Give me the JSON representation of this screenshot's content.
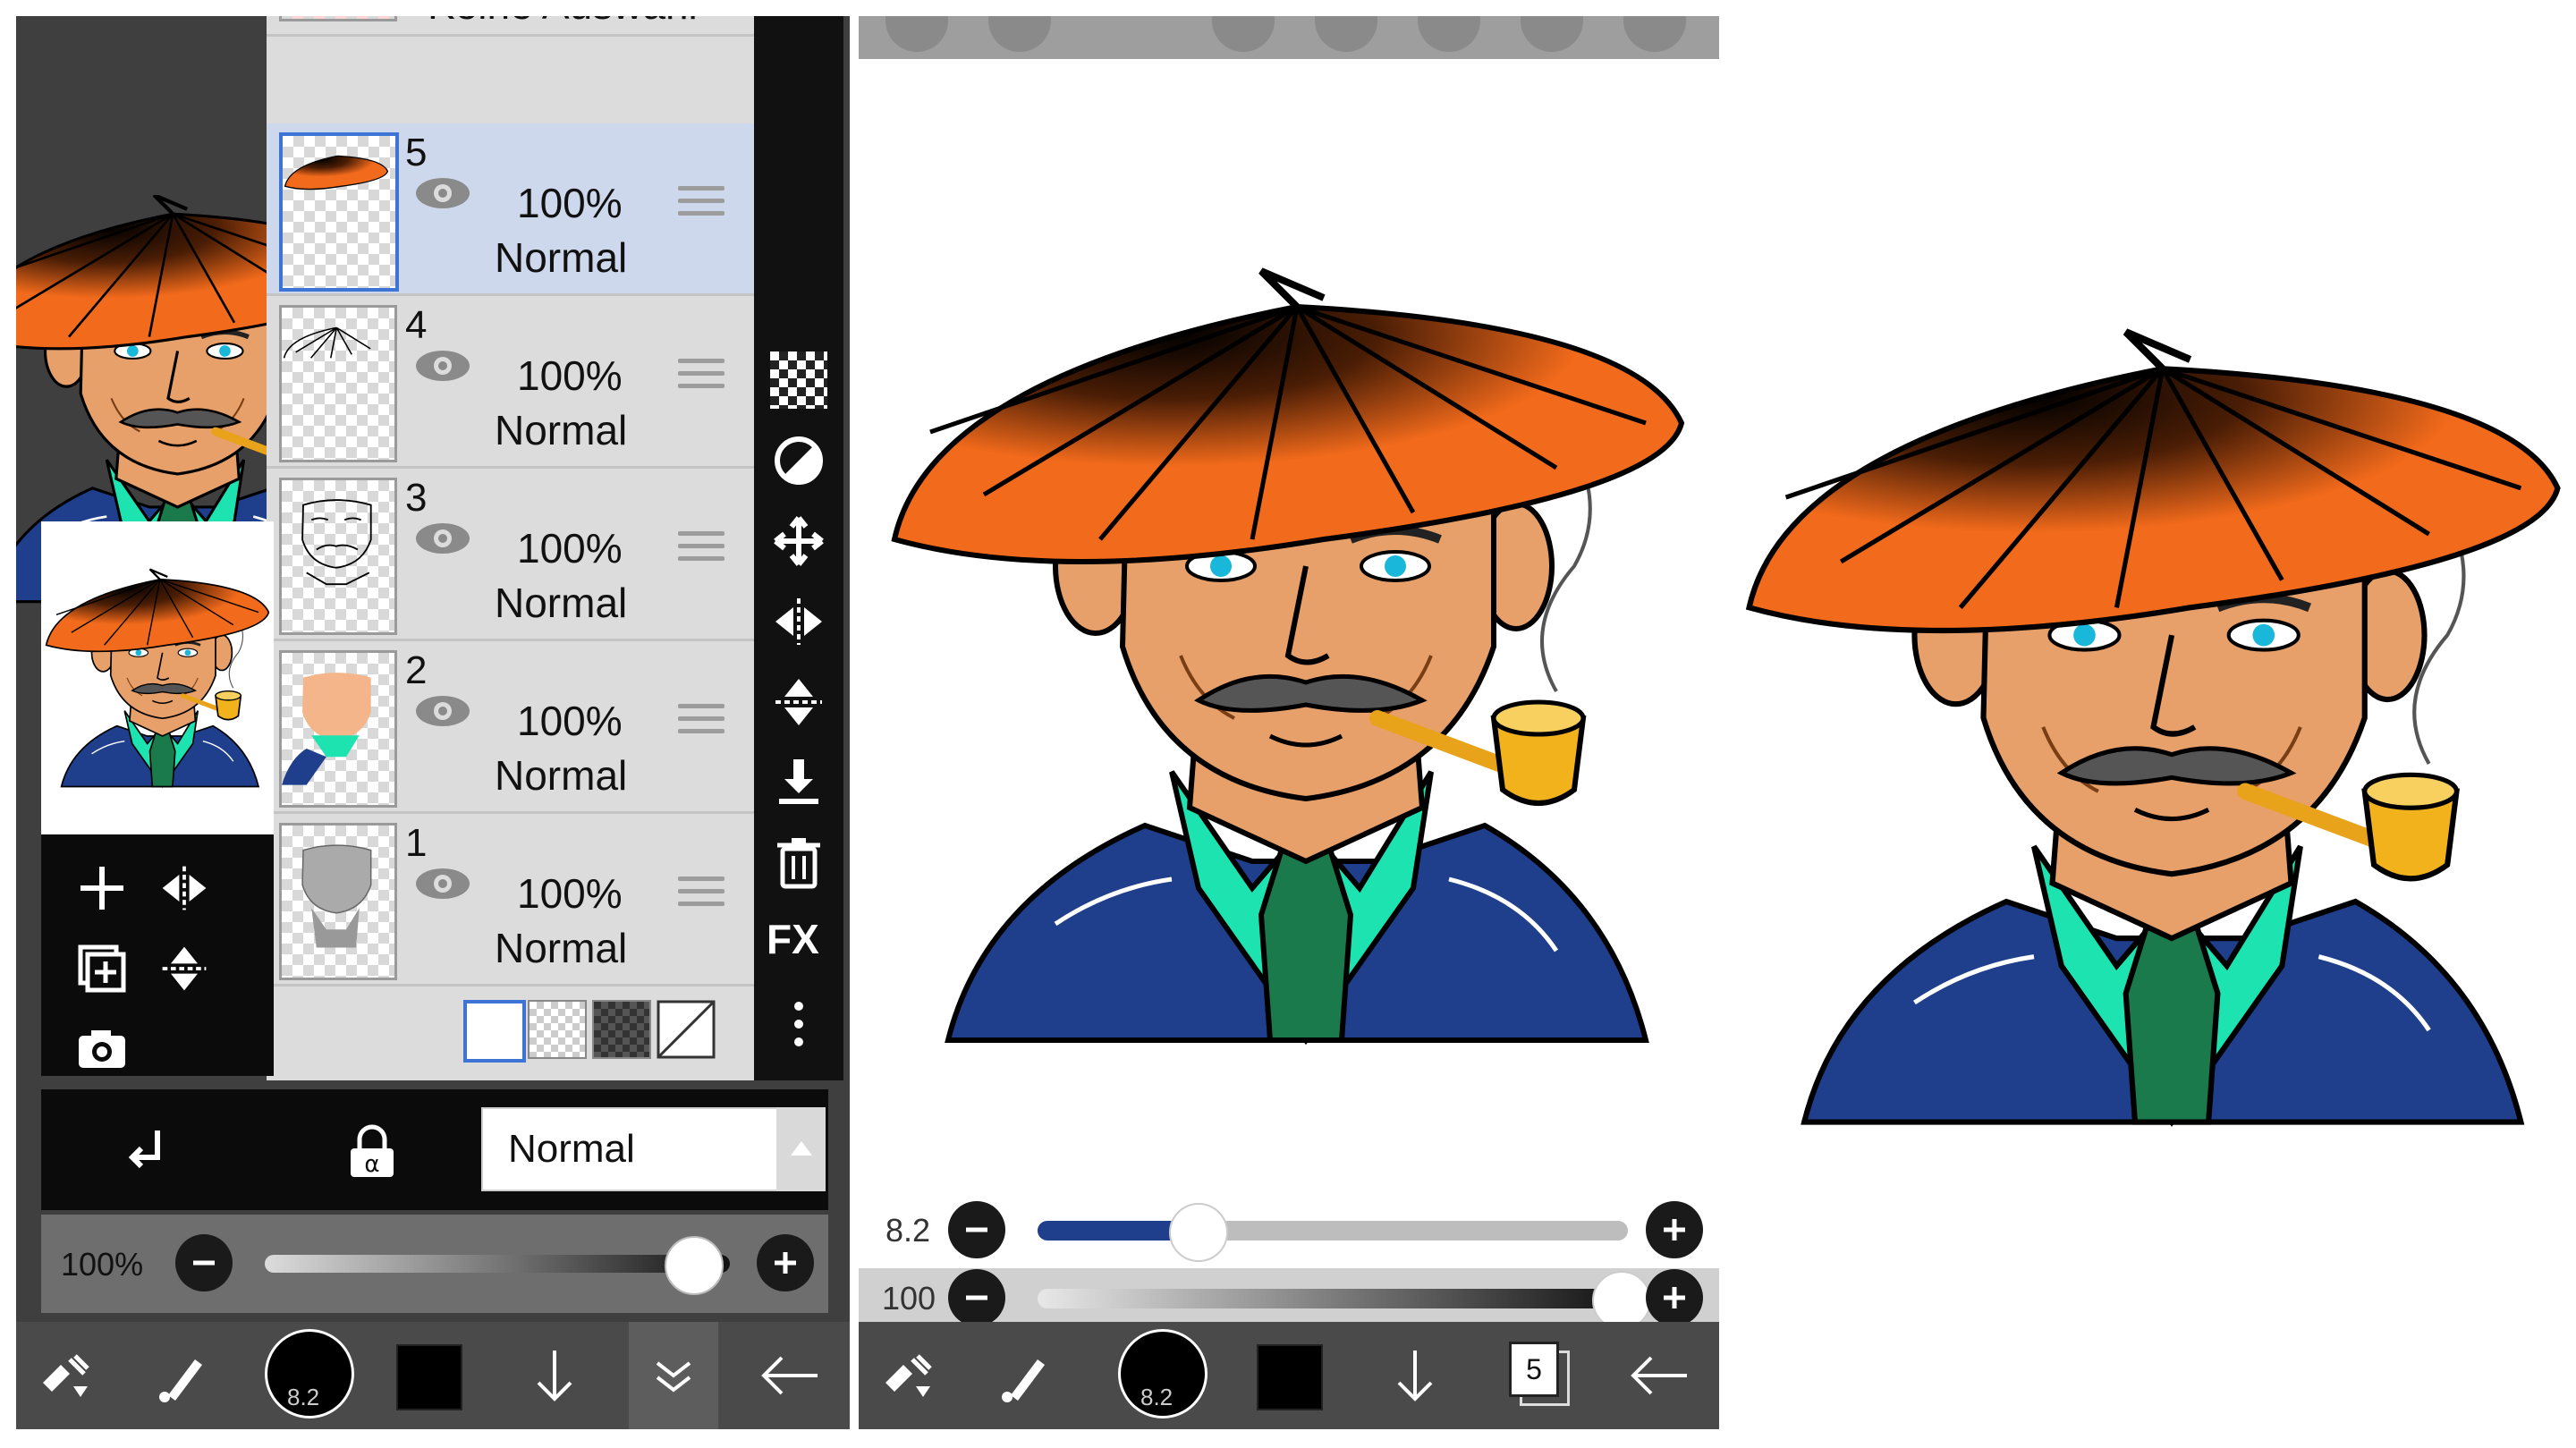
{
  "layers_panel": {
    "selection_layer_label": "Keine Auswahl",
    "layers": [
      {
        "number": "5",
        "opacity": "100%",
        "blend": "Normal",
        "selected": true
      },
      {
        "number": "4",
        "opacity": "100%",
        "blend": "Normal",
        "selected": false
      },
      {
        "number": "3",
        "opacity": "100%",
        "blend": "Normal",
        "selected": false
      },
      {
        "number": "2",
        "opacity": "100%",
        "blend": "Normal",
        "selected": false
      },
      {
        "number": "1",
        "opacity": "100%",
        "blend": "Normal",
        "selected": false
      }
    ],
    "side_tools": [
      "checker-icon",
      "circle-half-icon",
      "move-icon",
      "flip-horizontal-icon",
      "flip-vertical-icon",
      "merge-down-icon",
      "trash-icon",
      "fx-label",
      "more-icon"
    ],
    "fx_label": "FX",
    "blend_mode_value": "Normal",
    "opacity_value": "100%",
    "opacity_level": 0.92
  },
  "canvas_panel": {
    "brush_size_value": "8.2",
    "brush_size_level": 0.27,
    "brush_opacity_value": "100",
    "brush_opacity_level": 1.0,
    "layer_count_badge": "5"
  },
  "toolbar": {
    "brush_size_badge": "8.2"
  },
  "colors": {
    "hat_orange": "#f26a1b",
    "skin": "#e8a06a",
    "shirt_green": "#1de3b0",
    "tie_green": "#1b7a4b",
    "jacket_blue": "#1f3f8c",
    "selection_blue": "#3d74d6",
    "selected_row": "#cdd8ec"
  }
}
